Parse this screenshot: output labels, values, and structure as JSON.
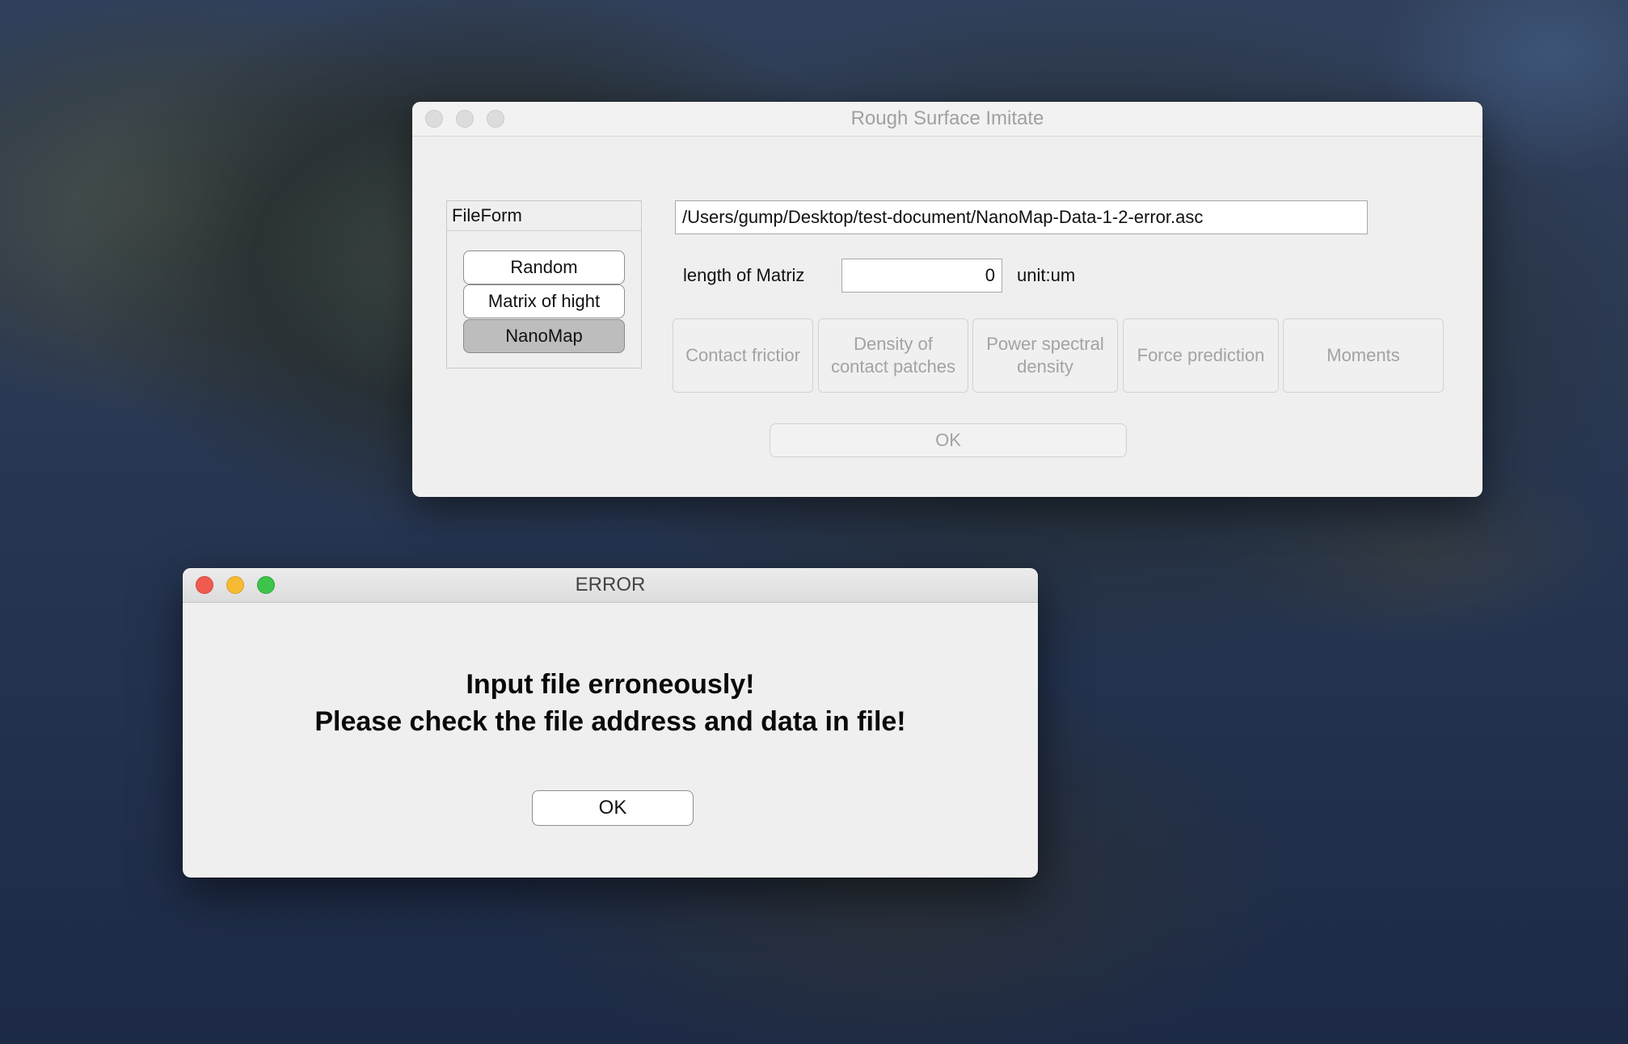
{
  "desktop": {
    "wallpaper": "coastal island at dusk"
  },
  "main_window": {
    "title": "Rough Surface Imitate",
    "fileform": {
      "title": "FileForm",
      "options": [
        "Random",
        "Matrix of hight",
        "NanoMap"
      ],
      "selected": "NanoMap"
    },
    "file_path": "/Users/gump/Desktop/test-document/NanoMap-Data-1-2-error.asc",
    "length_label": "length of Matriz",
    "length_value": "0",
    "unit_label": "unit:um",
    "functions": [
      "Contact frictior",
      "Density of\ncontact patches",
      "Power spectral\ndensity",
      "Force prediction",
      "Moments"
    ],
    "ok_label": "OK"
  },
  "error_dialog": {
    "title": "ERROR",
    "message_line1": "Input file erroneously!",
    "message_line2": "Please check the file address and data in file!",
    "ok_label": "OK"
  },
  "colors": {
    "close": "#f05a4f",
    "minimize": "#f6bb33",
    "zoom": "#3dc44a",
    "selected_button": "#bdbdbd",
    "disabled_text": "#a3a3a3"
  }
}
